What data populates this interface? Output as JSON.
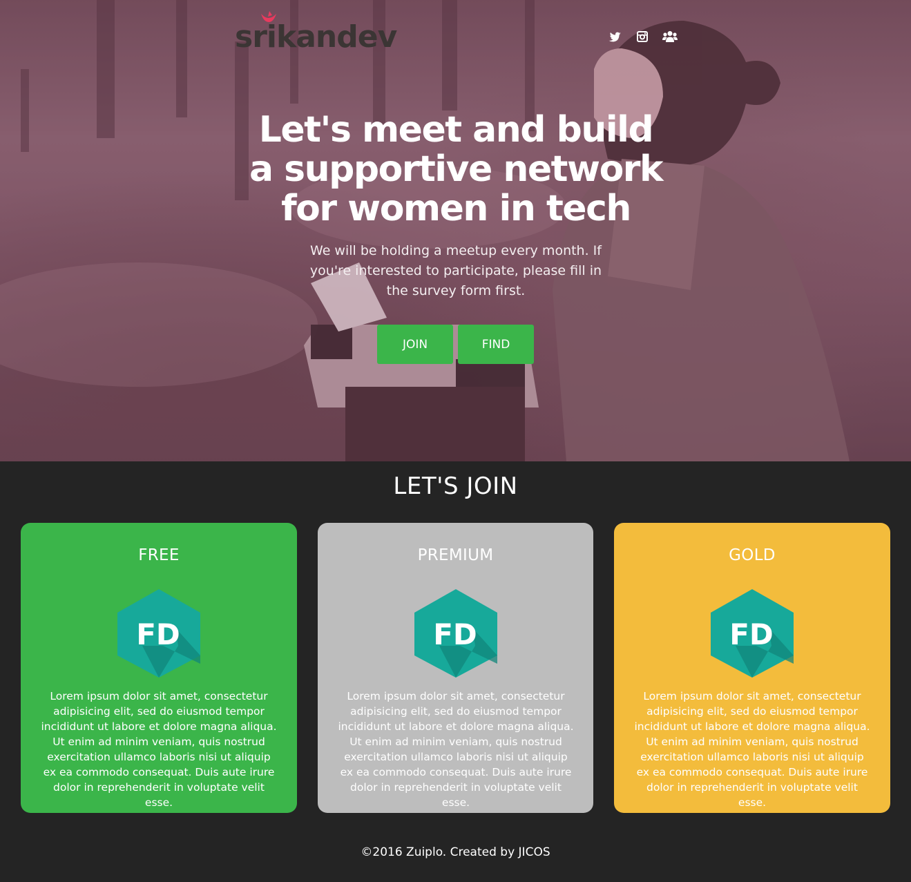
{
  "header": {
    "logo_text": "srikandev",
    "social": [
      "twitter-icon",
      "instagram-icon",
      "group-icon"
    ]
  },
  "hero": {
    "headline": "Let's meet and build a supportive network for women in tech",
    "subtext": "We will be holding a meetup every month. If you're interested to participate, please fill in the survey form first.",
    "join_label": "JOIN",
    "find_label": "FIND"
  },
  "plans": {
    "title": "LET'S JOIN",
    "badge_text": "FD",
    "items": [
      {
        "name": "FREE",
        "color": "#3bb54a",
        "text": "Lorem ipsum dolor sit amet, consectetur adipisicing elit, sed do eiusmod tempor incididunt ut labore et dolore magna aliqua. Ut enim ad minim veniam, quis nostrud exercitation ullamco laboris nisi ut aliquip ex ea commodo consequat. Duis aute irure dolor in reprehenderit in voluptate velit esse."
      },
      {
        "name": "PREMIUM",
        "color": "#bdbdbd",
        "text": "Lorem ipsum dolor sit amet, consectetur adipisicing elit, sed do eiusmod tempor incididunt ut labore et dolore magna aliqua. Ut enim ad minim veniam, quis nostrud exercitation ullamco laboris nisi ut aliquip ex ea commodo consequat. Duis aute irure dolor in reprehenderit in voluptate velit esse."
      },
      {
        "name": "GOLD",
        "color": "#f3bc3c",
        "text": "Lorem ipsum dolor sit amet, consectetur adipisicing elit, sed do eiusmod tempor incididunt ut labore et dolore magna aliqua. Ut enim ad minim veniam, quis nostrud exercitation ullamco laboris nisi ut aliquip ex ea commodo consequat. Duis aute irure dolor in reprehenderit in voluptate velit esse."
      }
    ]
  },
  "footer": {
    "text": "©2016 Zuiplo. Created by JICOS"
  },
  "colors": {
    "accent_green": "#3bb54a",
    "badge_teal": "#17a99a",
    "background_dark": "#242424",
    "logo_pink": "#e83a5e"
  }
}
